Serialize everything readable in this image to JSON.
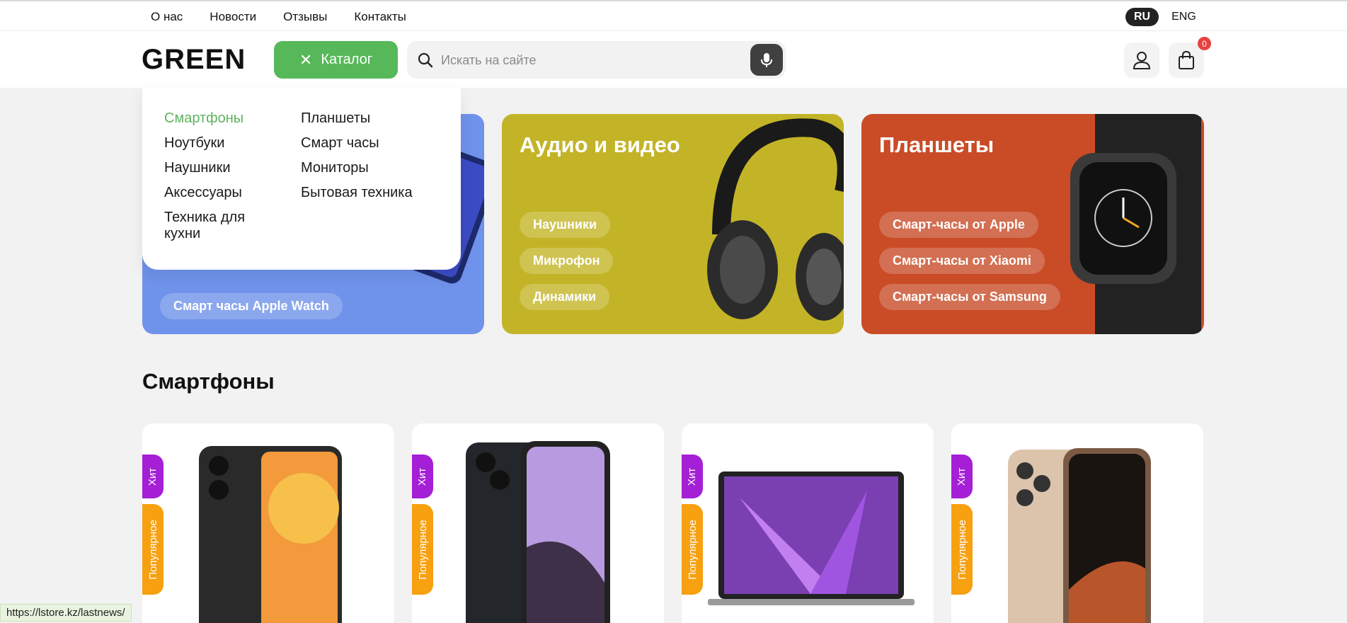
{
  "topnav": {
    "items": [
      {
        "label": "О нас"
      },
      {
        "label": "Новости"
      },
      {
        "label": "Отзывы"
      },
      {
        "label": "Контакты"
      }
    ],
    "languages": {
      "active": "RU",
      "other": "ENG"
    }
  },
  "header": {
    "logo": "GREEN",
    "catalog_label": "Каталог",
    "search_placeholder": "Искать на сайте",
    "cart_count": "0"
  },
  "catalog_menu": {
    "col1": [
      "Смартфоны",
      "Ноутбуки",
      "Наушники",
      "Аксессуары",
      "Техника для кухни"
    ],
    "col2": [
      "Планшеты",
      "Смарт часы",
      "Мониторы",
      "Бытовая техника"
    ],
    "active_item": "Смартфоны"
  },
  "banners": [
    {
      "title": "",
      "chips": [
        "Смарт часы Apple Watch"
      ],
      "color": "#6f92ea"
    },
    {
      "title": "Аудио и видео",
      "chips": [
        "Наушники",
        "Микрофон",
        "Динамики"
      ],
      "color": "#c3b427"
    },
    {
      "title": "Планшеты",
      "chips": [
        "Смарт-часы от Apple",
        "Смарт-часы от Xiaomi",
        "Смарт-часы от Samsung"
      ],
      "color": "#c94c27"
    }
  ],
  "section": {
    "title": "Смартфоны"
  },
  "products": [
    {
      "tags": [
        "Хит",
        "Популярное"
      ],
      "image": "redmi-phone"
    },
    {
      "tags": [
        "Хит",
        "Популярное"
      ],
      "image": "iphone-14"
    },
    {
      "tags": [
        "Хит",
        "Популярное"
      ],
      "image": "macbook-air"
    },
    {
      "tags": [
        "Хит",
        "Популярное"
      ],
      "image": "iphone-16-pro"
    }
  ],
  "status_bar": {
    "url": "https://lstore.kz/lastnews/"
  },
  "colors": {
    "accent_green": "#57b85a",
    "hit_tag": "#a51fd6",
    "popular_tag": "#f7a010",
    "badge": "#e84040"
  }
}
